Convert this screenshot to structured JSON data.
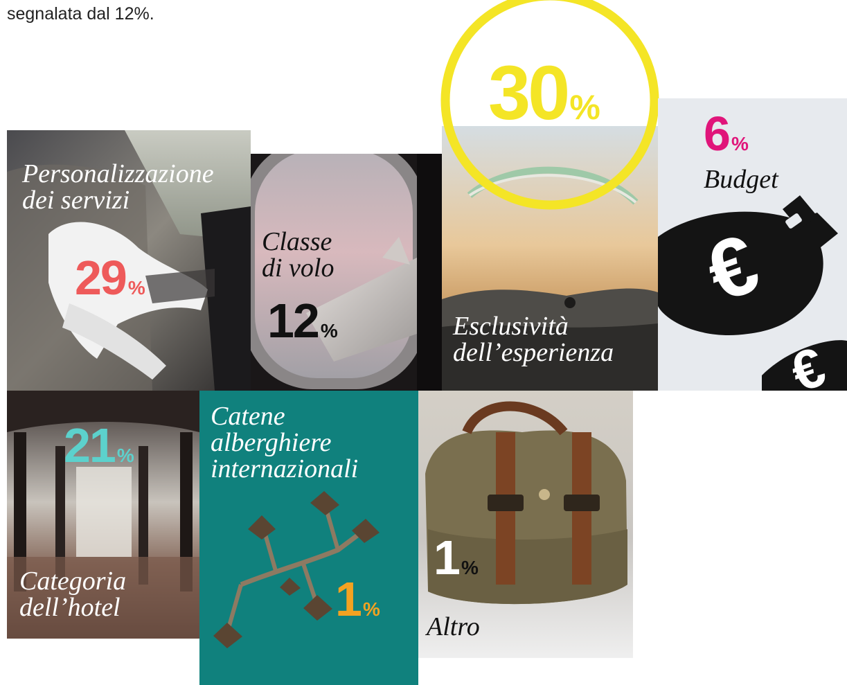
{
  "intro_text": "segnalata dal 12%.",
  "tiles": [
    {
      "label_lines": [
        "Personalizzazione",
        "dei servizi"
      ],
      "value": "29",
      "unit": "%",
      "color": "#ee5a5a"
    },
    {
      "label_lines": [
        "Classe",
        "di volo"
      ],
      "value": "12",
      "unit": "%",
      "color": "#111111"
    },
    {
      "label_lines": [
        "Esclusività",
        "dell’esperienza"
      ],
      "value": "30",
      "unit": "%",
      "color": "#f4e526"
    },
    {
      "label_lines": [
        "Budget"
      ],
      "value": "6",
      "unit": "%",
      "color": "#e0157a"
    },
    {
      "label_lines": [
        "Categoria",
        "dell’hotel"
      ],
      "value": "21",
      "unit": "%",
      "color": "#5cd1cc"
    },
    {
      "label_lines": [
        "Catene",
        "alberghiere",
        "internazionali"
      ],
      "value": "1",
      "unit": "%",
      "color": "#f3a221"
    },
    {
      "label_lines": [
        "Altro"
      ],
      "value": "1",
      "unit": "%",
      "color": "#ffffff"
    }
  ]
}
